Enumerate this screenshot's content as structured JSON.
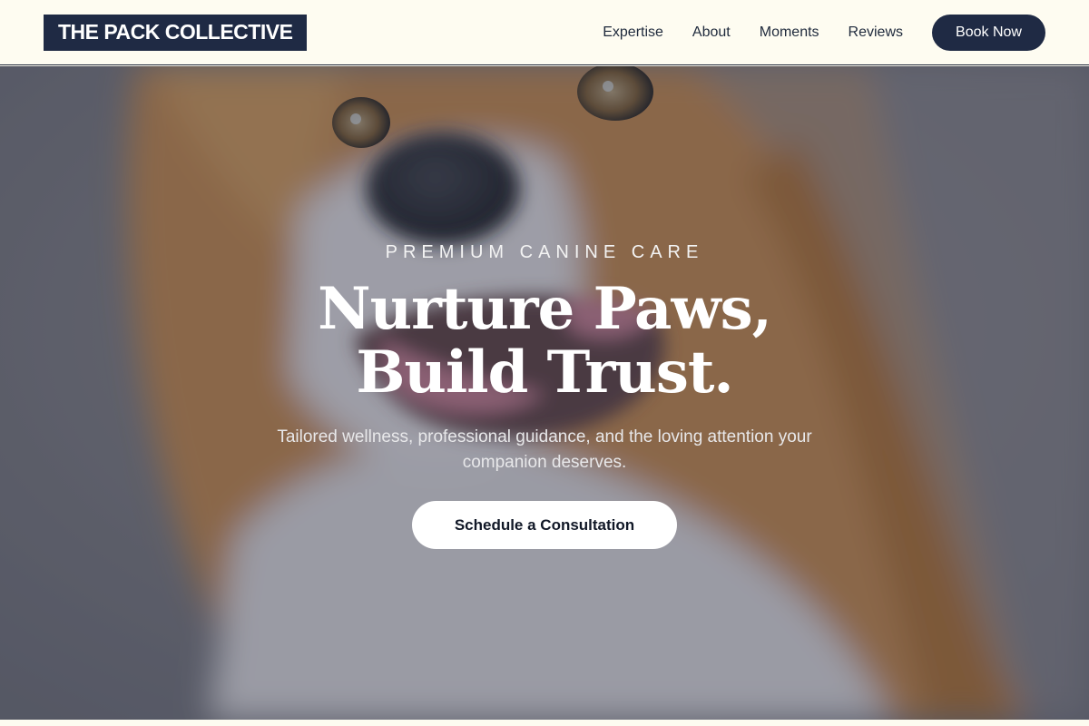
{
  "nav": {
    "logo": "THE PACK COLLECTIVE",
    "links": [
      "Expertise",
      "About",
      "Moments",
      "Reviews"
    ],
    "cta_label": "Book Now"
  },
  "hero": {
    "image_alt": "Close-up of a smiling sable and white corgi dog",
    "eyebrow": "PREMIUM CANINE CARE",
    "headline_line1": "Nurture Paws,",
    "headline_line2": "Build Trust.",
    "subtext": "Tailored wellness, professional guidance, and the loving attention your companion deserves.",
    "cta_label": "Schedule a Consultation"
  },
  "colors": {
    "navy": "#1f2a44",
    "cream": "#fefcf1",
    "white": "#ffffff"
  }
}
